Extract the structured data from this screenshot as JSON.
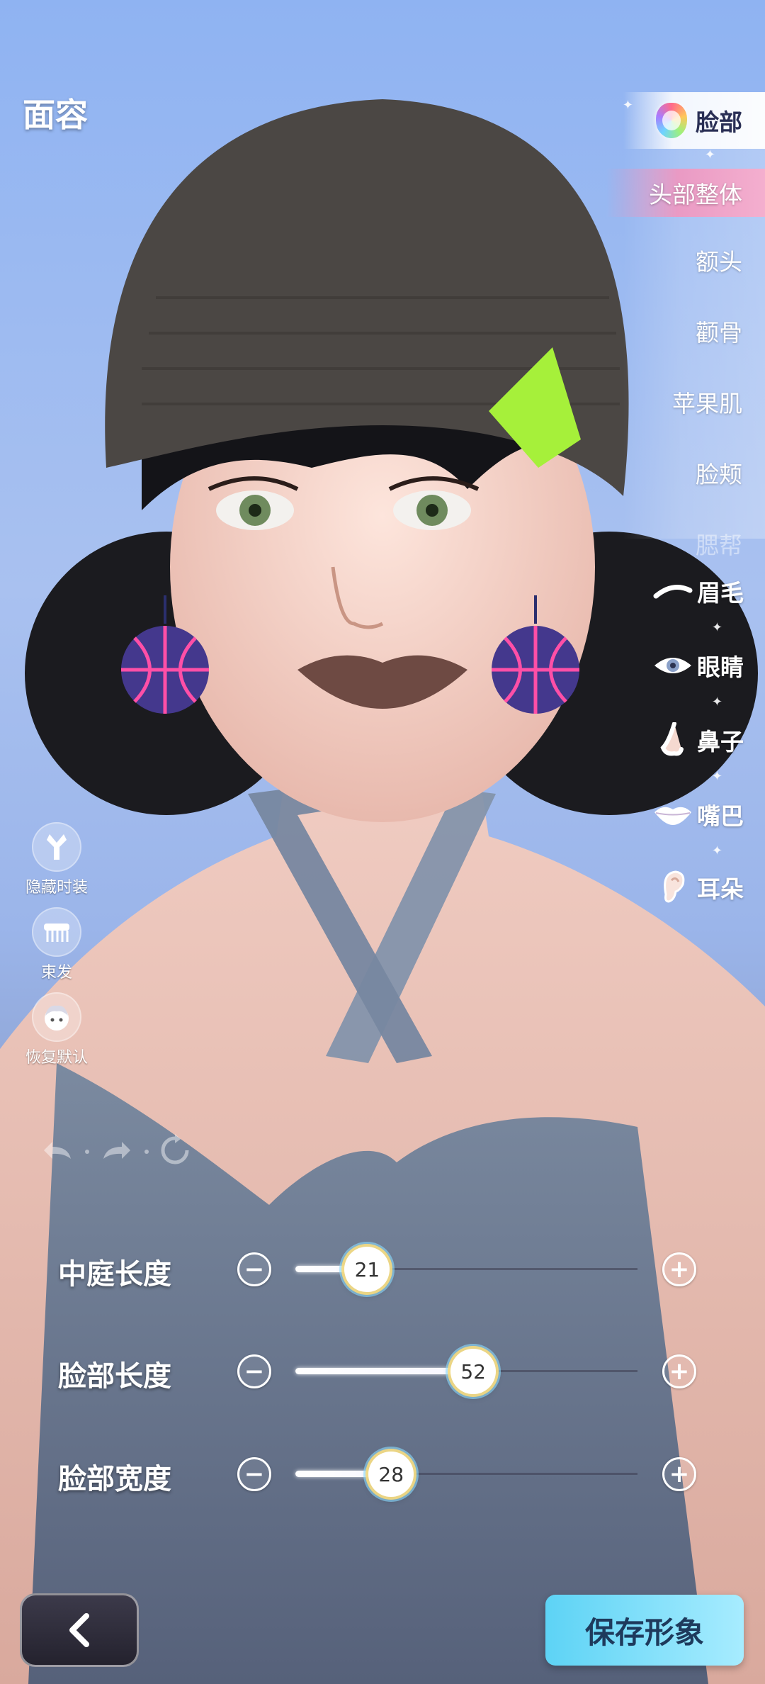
{
  "header": {
    "title": "面容"
  },
  "category": {
    "label": "脸部",
    "icon": "rainbow-face-icon",
    "sub_items": [
      "头部整体",
      "额头",
      "颧骨",
      "苹果肌",
      "脸颊",
      "腮帮"
    ],
    "active_sub_item": "头部整体",
    "features": [
      {
        "label": "眉毛",
        "icon": "eyebrow-icon"
      },
      {
        "label": "眼睛",
        "icon": "eye-icon"
      },
      {
        "label": "鼻子",
        "icon": "nose-icon"
      },
      {
        "label": "嘴巴",
        "icon": "lips-icon"
      },
      {
        "label": "耳朵",
        "icon": "ear-icon"
      }
    ]
  },
  "tools": [
    {
      "label": "隐藏时装",
      "icon": "hide-outfit-icon"
    },
    {
      "label": "束发",
      "icon": "comb-icon"
    },
    {
      "label": "恢复默认",
      "icon": "face-reset-icon"
    }
  ],
  "history": {
    "undo": "undo-icon",
    "redo": "redo-icon",
    "reset": "reset-icon"
  },
  "sliders": [
    {
      "label": "中庭长度",
      "value": "21",
      "fraction": 0.21
    },
    {
      "label": "脸部长度",
      "value": "52",
      "fraction": 0.52
    },
    {
      "label": "脸部宽度",
      "value": "28",
      "fraction": 0.28
    }
  ],
  "buttons": {
    "back_icon": "chevron-left-icon",
    "save": "保存形象"
  },
  "colors": {
    "accent_pink": "#ff8cb4",
    "save_cyan": "#5dd3f5"
  }
}
